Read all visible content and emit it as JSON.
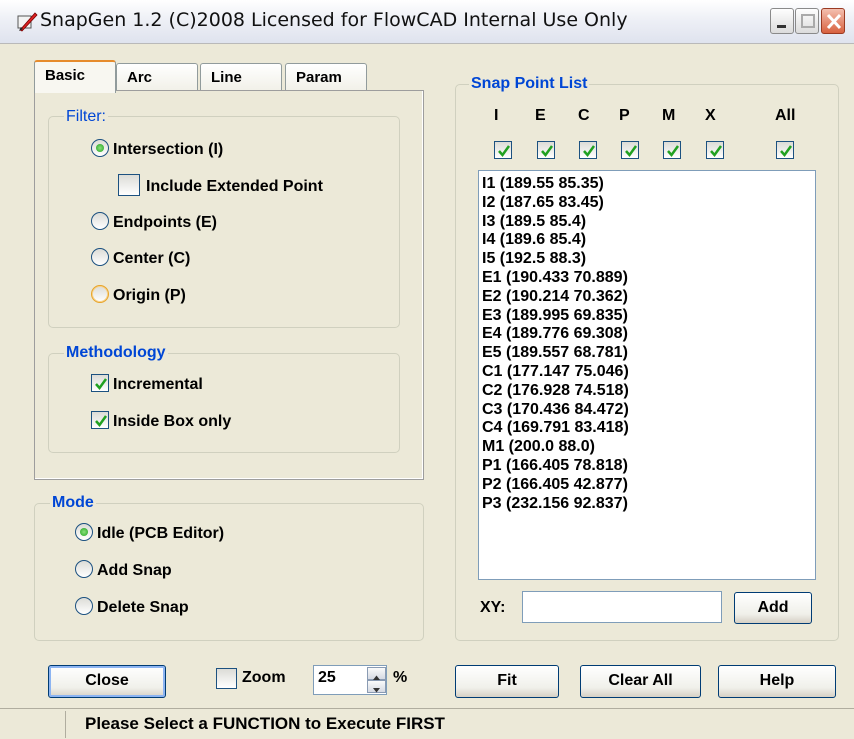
{
  "window": {
    "title": "SnapGen 1.2 (C)2008 Licensed for FlowCAD Internal Use Only",
    "app_icon": "pen-icon",
    "buttons": [
      "minimize-icon",
      "maximize-icon",
      "close-icon"
    ]
  },
  "tabs": [
    {
      "label": "Basic",
      "active": true
    },
    {
      "label": "Arc",
      "active": false
    },
    {
      "label": "Line",
      "active": false
    },
    {
      "label": "Param",
      "active": false
    }
  ],
  "filter": {
    "label": "Filter:",
    "intersection": "Intersection (I)",
    "include_extended": "Include Extended Point",
    "endpoints": "Endpoints (E)",
    "center": "Center  (C)",
    "origin": "Origin  (P)",
    "selected": "intersection",
    "include_extended_checked": false
  },
  "methodology": {
    "label": "Methodology",
    "incremental": "Incremental",
    "incremental_checked": true,
    "inside_box": "Inside Box only",
    "inside_box_checked": true
  },
  "mode": {
    "label": "Mode",
    "idle": "Idle (PCB Editor)",
    "add": "Add Snap",
    "delete": "Delete Snap",
    "selected": "idle"
  },
  "snap_list": {
    "label": "Snap Point List",
    "columns": [
      "I",
      "E",
      "C",
      "P",
      "M",
      "X",
      "All"
    ],
    "columns_checked": [
      true,
      true,
      true,
      true,
      true,
      true,
      true
    ],
    "items": [
      "I1 (189.55 85.35)",
      "I2 (187.65 83.45)",
      "I3 (189.5 85.4)",
      "I4 (189.6 85.4)",
      "I5 (192.5 88.3)",
      "E1 (190.433 70.889)",
      "E2 (190.214 70.362)",
      "E3 (189.995 69.835)",
      "E4 (189.776 69.308)",
      "E5 (189.557 68.781)",
      "C1 (177.147 75.046)",
      "C2 (176.928 74.518)",
      "C3 (170.436 84.472)",
      "C4 (169.791 83.418)",
      "M1 (200.0 88.0)",
      "P1 (166.405 78.818)",
      "P2 (166.405 42.877)",
      "P3 (232.156 92.837)"
    ],
    "xy_label": "XY:",
    "xy_value": "",
    "add_label": "Add"
  },
  "bottom": {
    "close_label": "Close",
    "zoom_label": "Zoom",
    "zoom_checked": false,
    "zoom_value": "25",
    "percent": "%",
    "fit_label": "Fit",
    "clear_all_label": "Clear All",
    "help_label": "Help"
  },
  "status": {
    "text": "Please Select a FUNCTION to Execute FIRST"
  },
  "colors": {
    "group_label": "#0046d5",
    "check": "#21a121",
    "titlebar": "#eef0f6"
  }
}
